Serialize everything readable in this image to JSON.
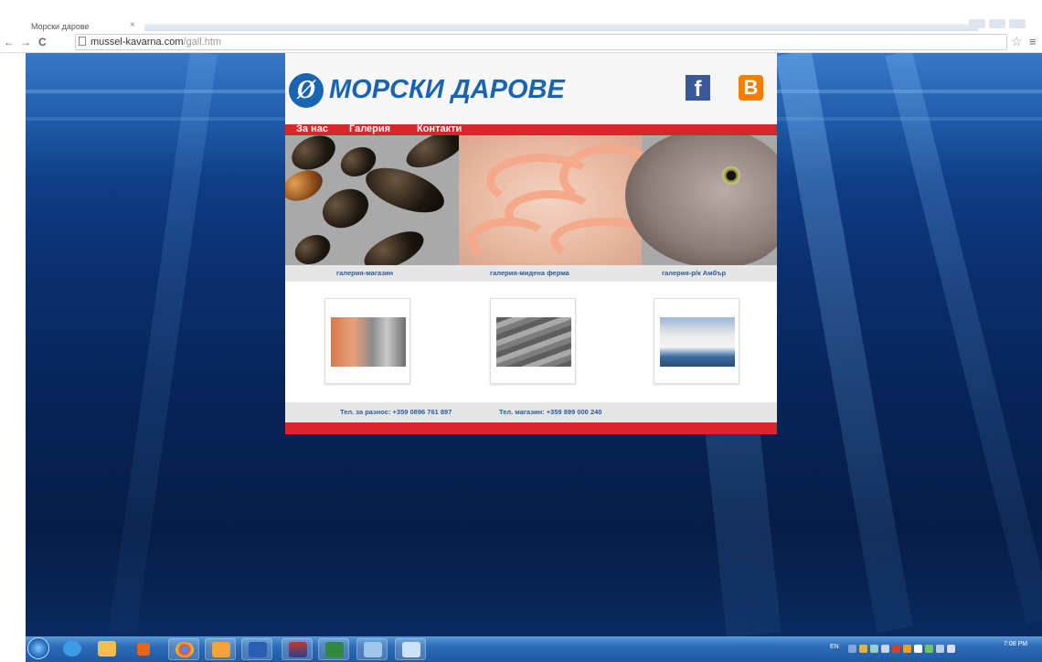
{
  "browser": {
    "tab_title": "Морски дарове",
    "tab_close": "×",
    "url_host": "mussel-kavarna.com",
    "url_path": "/gall.htm",
    "back": "←",
    "forward": "→",
    "reload": "C",
    "bookmark_icon": "star-icon",
    "menu_icon": "≡"
  },
  "site": {
    "logo_mark": "Ø",
    "logo_text": "МОРСКИ ДАРОВЕ",
    "facebook_glyph": "f",
    "blogger_glyph": "B",
    "nav": [
      "За нас",
      "Галерия",
      "Контакти"
    ],
    "gallery_labels": [
      "галерия-магазин",
      "галерия-мидена ферма",
      "галерия-р/к Амбър"
    ],
    "phones": [
      "Тел. за разнос: +359 0896 761 897",
      "Тел. магазин: +359 899 000 240"
    ],
    "colors": {
      "brand_blue": "#1a64b4",
      "accent_red": "#d9262b",
      "label_blue": "#2d5b9a"
    }
  },
  "taskbar": {
    "apps": [
      "internet-explorer",
      "file-explorer",
      "media-player",
      "chrome",
      "outlook",
      "word",
      "app-flag",
      "excel",
      "paint",
      "remote-desktop"
    ],
    "language": "EN",
    "time": "7:08 PM",
    "date": ""
  }
}
